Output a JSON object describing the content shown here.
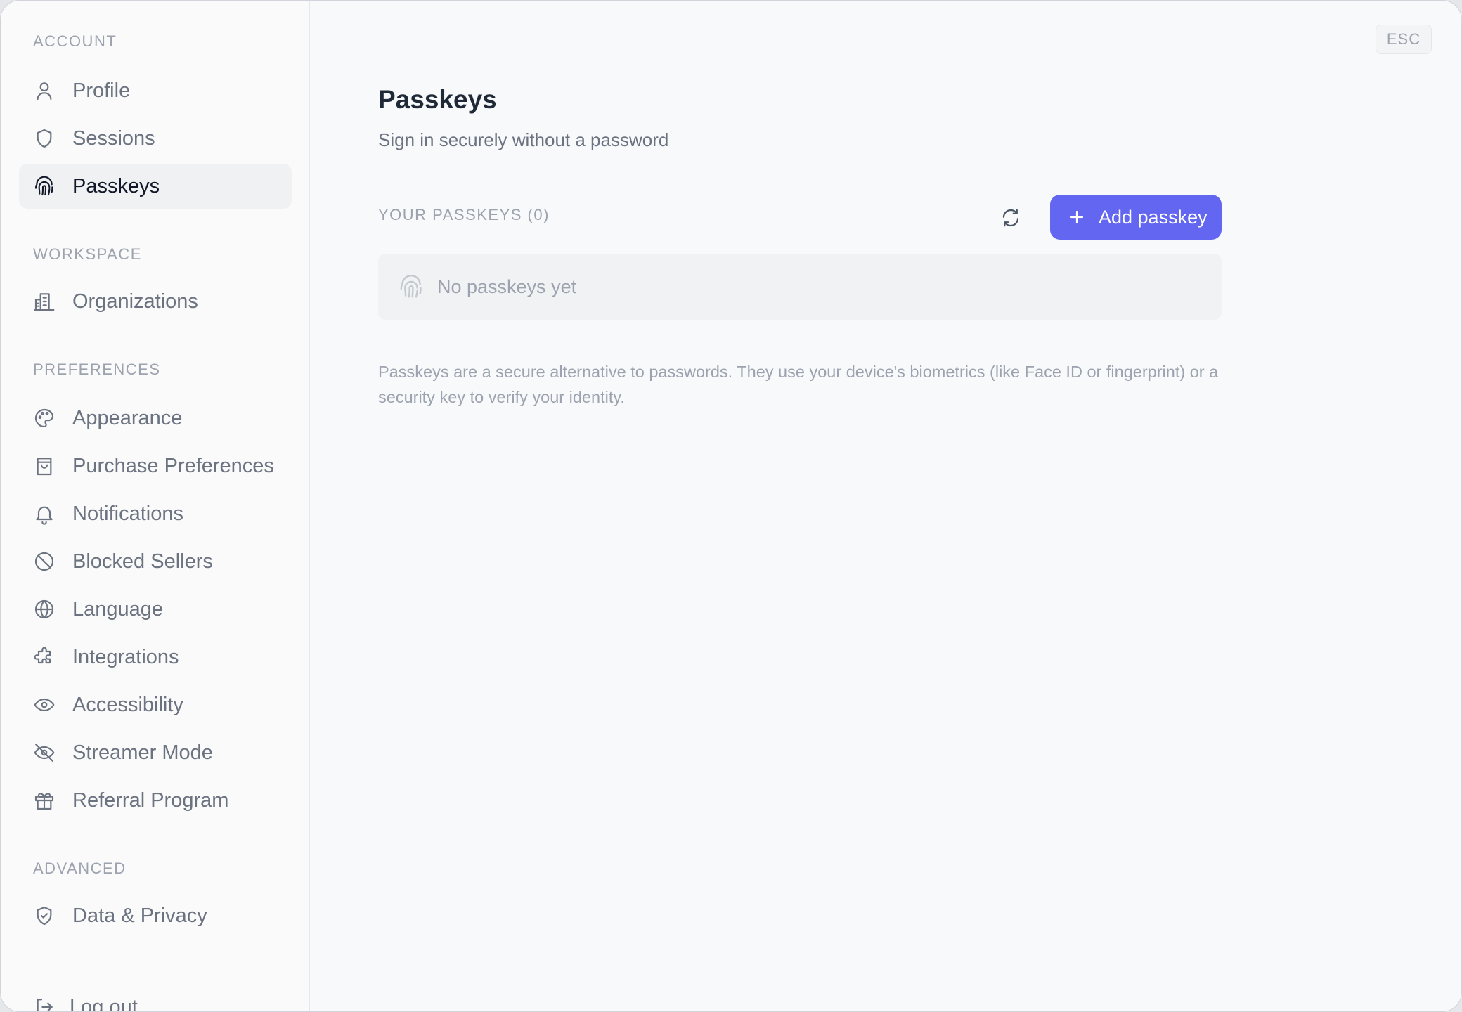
{
  "sidebar": {
    "sections": {
      "account": "ACCOUNT",
      "workspace": "WORKSPACE",
      "preferences": "PREFERENCES",
      "advanced": "ADVANCED"
    },
    "items": {
      "profile": "Profile",
      "sessions": "Sessions",
      "passkeys": "Passkeys",
      "organizations": "Organizations",
      "appearance": "Appearance",
      "purchase_preferences": "Purchase Preferences",
      "notifications": "Notifications",
      "blocked_sellers": "Blocked Sellers",
      "language": "Language",
      "integrations": "Integrations",
      "accessibility": "Accessibility",
      "streamer_mode": "Streamer Mode",
      "referral_program": "Referral Program",
      "data_privacy": "Data & Privacy"
    },
    "active_item": "passkeys",
    "logout": "Log out"
  },
  "main": {
    "esc_label": "ESC",
    "title": "Passkeys",
    "subtitle": "Sign in securely without a password",
    "list_label": "YOUR PASSKEYS (0)",
    "add_button": "Add passkey",
    "empty_text": "No passkeys yet",
    "description": "Passkeys are a secure alternative to passwords. They use your device's biometrics (like Face ID or fingerprint) or a security key to verify your identity."
  },
  "icons": {
    "profile": "user-icon",
    "sessions": "shield-icon",
    "passkeys": "fingerprint-icon",
    "organizations": "building-icon",
    "appearance": "palette-icon",
    "purchase_preferences": "shopping-bag-icon",
    "notifications": "bell-icon",
    "blocked_sellers": "ban-icon",
    "language": "globe-icon",
    "integrations": "puzzle-icon",
    "accessibility": "eye-icon",
    "streamer_mode": "eye-off-icon",
    "referral_program": "gift-icon",
    "data_privacy": "shield-check-icon",
    "logout": "log-out-icon",
    "refresh": "refresh-icon",
    "add": "plus-icon"
  },
  "colors": {
    "accent": "#6366f1",
    "active_bg": "#f0f1f3",
    "muted_text": "#9ca3af",
    "nav_text": "#6b7280"
  }
}
